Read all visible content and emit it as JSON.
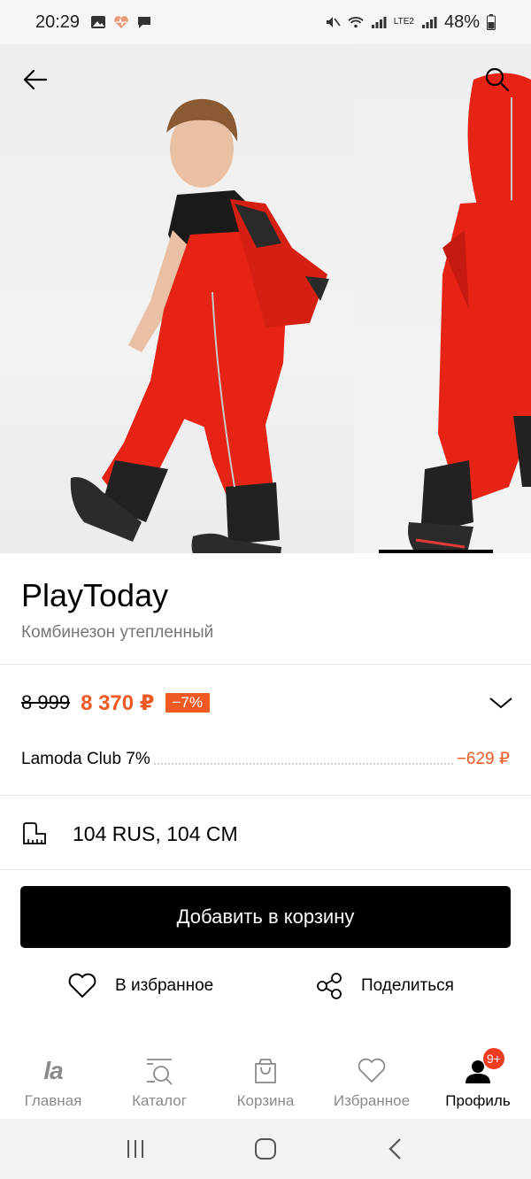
{
  "status_bar": {
    "time": "20:29",
    "battery": "48%",
    "network_label": "LTE2"
  },
  "gallery": {
    "image_count_visible": 2,
    "progress_fraction": 0.22
  },
  "product": {
    "brand": "PlayToday",
    "name": "Комбинезон утепленный"
  },
  "price": {
    "old": "8 999",
    "new": "8 370 ₽",
    "discount": "−7%"
  },
  "club": {
    "label": "Lamoda Club 7%",
    "value": "−629 ₽"
  },
  "size": {
    "value": "104 RUS, 104 CM"
  },
  "actions": {
    "add_to_cart": "Добавить в корзину",
    "favorite": "В избранное",
    "share": "Поделиться"
  },
  "bottom_nav": {
    "items": [
      {
        "label": "Главная",
        "icon": "lamoda-logo-icon"
      },
      {
        "label": "Каталог",
        "icon": "catalog-icon"
      },
      {
        "label": "Корзина",
        "icon": "cart-icon"
      },
      {
        "label": "Избранное",
        "icon": "heart-icon"
      },
      {
        "label": "Профиль",
        "icon": "profile-icon",
        "badge": "9+",
        "active": true
      }
    ],
    "logo_text": "la"
  },
  "colors": {
    "accent": "#ef5a24",
    "badge": "#ef3b1e",
    "button": "#000000"
  }
}
